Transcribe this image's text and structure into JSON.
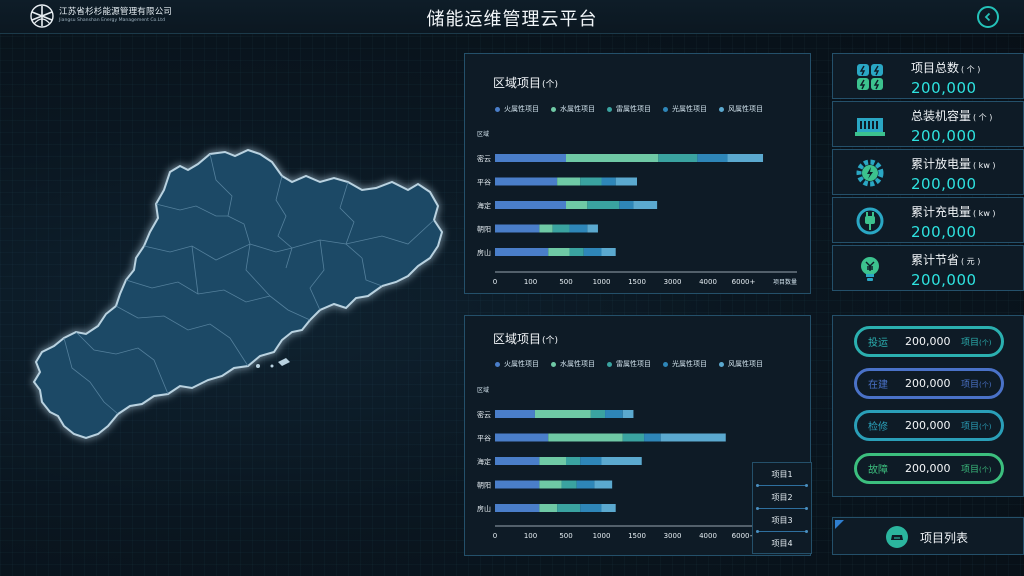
{
  "header": {
    "logo_cn": "江苏省杉杉能源管理有限公司",
    "logo_en": "Jiangsu Shanshan Energy Management Co.Ltd",
    "title": "储能运维管理云平台",
    "back_icon": "chevron-left-circle-icon"
  },
  "map": {
    "region": "guangdong-map",
    "fill_color": "#1e4a66"
  },
  "legend": [
    {
      "label": "火属性项目",
      "color": "#4a7ec9"
    },
    {
      "label": "水属性项目",
      "color": "#6fc9a5"
    },
    {
      "label": "雷属性项目",
      "color": "#3aa3a0"
    },
    {
      "label": "光属性项目",
      "color": "#2e86b8"
    },
    {
      "label": "风属性项目",
      "color": "#5ba9cf"
    }
  ],
  "chart_data": [
    {
      "type": "bar",
      "orientation": "horizontal",
      "stacked": true,
      "title": "区域项目",
      "title_unit": "(个)",
      "ylabel": "区域",
      "xlabel": "项目数量",
      "categories": [
        "密云",
        "平谷",
        "海定",
        "朝阳",
        "房山"
      ],
      "x_ticks": [
        "0",
        "100",
        "500",
        "1000",
        "1500",
        "3000",
        "4000",
        "6000+"
      ],
      "series": [
        {
          "name": "火属性项目",
          "values": [
            500,
            400,
            500,
            200,
            300
          ]
        },
        {
          "name": "水属性项目",
          "values": [
            1900,
            300,
            300,
            150,
            250
          ]
        },
        {
          "name": "雷属性项目",
          "values": [
            1300,
            300,
            450,
            200,
            200
          ]
        },
        {
          "name": "光属性项目",
          "values": [
            1400,
            200,
            200,
            250,
            250
          ]
        },
        {
          "name": "风属性项目",
          "values": [
            2000,
            300,
            900,
            150,
            200
          ]
        }
      ]
    },
    {
      "type": "bar",
      "orientation": "horizontal",
      "stacked": true,
      "title": "区域项目",
      "title_unit": "(个)",
      "ylabel": "区域",
      "categories": [
        "密云",
        "平谷",
        "海定",
        "朝阳",
        "房山"
      ],
      "x_ticks": [
        "0",
        "100",
        "500",
        "1000",
        "1500",
        "3000",
        "4000",
        "6000+"
      ],
      "series": [
        {
          "name": "火属性项目",
          "values": [
            150,
            300,
            200,
            200,
            200
          ]
        },
        {
          "name": "水属性项目",
          "values": [
            700,
            1000,
            300,
            250,
            200
          ]
        },
        {
          "name": "雷属性项目",
          "values": [
            200,
            500,
            200,
            200,
            300
          ]
        },
        {
          "name": "光属性项目",
          "values": [
            250,
            700,
            300,
            250,
            300
          ]
        },
        {
          "name": "风属性项目",
          "values": [
            150,
            2500,
            700,
            250,
            200
          ]
        }
      ]
    }
  ],
  "item_list": [
    "项目1",
    "项目2",
    "项目3",
    "项目4"
  ],
  "stats": [
    {
      "label": "项目总数",
      "unit": "( 个 )",
      "value": "200,000",
      "icon": "project-count-icon"
    },
    {
      "label": "总装机容量",
      "unit": "( 个 )",
      "value": "200,000",
      "icon": "server-capacity-icon"
    },
    {
      "label": "累计放电量",
      "unit": "( kw )",
      "value": "200,000",
      "icon": "discharge-gear-icon"
    },
    {
      "label": "累计充电量",
      "unit": "( kw )",
      "value": "200,000",
      "icon": "charge-plug-icon"
    },
    {
      "label": "累计节省",
      "unit": "( 元 )",
      "value": "200,000",
      "icon": "savings-bulb-icon"
    }
  ],
  "status": [
    {
      "name": "投运",
      "value": "200,000",
      "unit": "项目",
      "unit_small": "(个)",
      "color": "#2bb0b0"
    },
    {
      "name": "在建",
      "value": "200,000",
      "unit": "项目",
      "unit_small": "(个)",
      "color": "#4a72c8"
    },
    {
      "name": "检修",
      "value": "200,000",
      "unit": "项目",
      "unit_small": "(个)",
      "color": "#2a9fb8"
    },
    {
      "name": "故障",
      "value": "200,000",
      "unit": "项目",
      "unit_small": "(个)",
      "color": "#3cbf7e"
    }
  ],
  "project_list_button": "项目列表"
}
